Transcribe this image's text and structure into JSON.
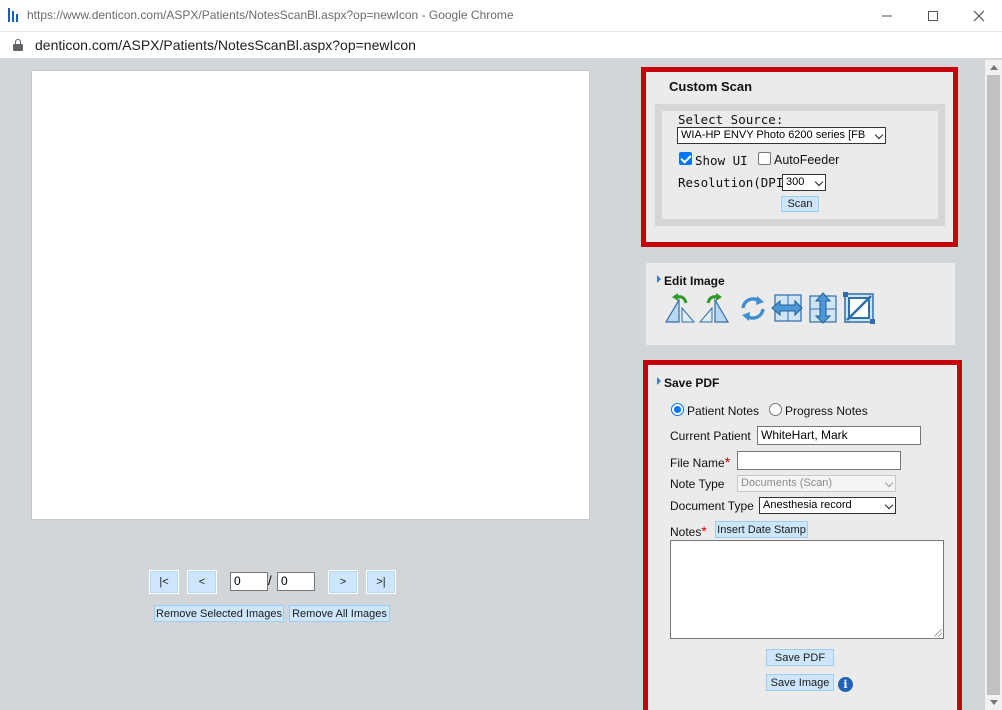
{
  "window": {
    "title": "https://www.denticon.com/ASPX/Patients/NotesScanBl.aspx?op=newIcon - Google Chrome",
    "address": "denticon.com/ASPX/Patients/NotesScanBl.aspx?op=newIcon"
  },
  "pager": {
    "first_label": "|<",
    "prev_label": "<",
    "current_page": "0",
    "separator": "/",
    "total_pages": "0",
    "next_label": ">",
    "last_label": ">|",
    "remove_selected_label": "Remove Selected Images",
    "remove_all_label": "Remove All Images"
  },
  "custom_scan": {
    "title": "Custom Scan",
    "source_label": "Select Source:",
    "source_value": "WIA-HP ENVY Photo 6200 series [FB",
    "show_ui_label": "Show UI",
    "show_ui_checked": true,
    "autofeeder_label": "AutoFeeder",
    "autofeeder_checked": false,
    "resolution_label": "Resolution(DPI):",
    "resolution_value": "300",
    "scan_label": "Scan"
  },
  "edit_image": {
    "title": "Edit Image",
    "tools": [
      "rotate-left-icon",
      "rotate-right-icon",
      "rotate-180-icon",
      "flip-horizontal-icon",
      "flip-vertical-icon",
      "crop-icon"
    ]
  },
  "save_pdf": {
    "title": "Save PDF",
    "note_kind_options": [
      "Patient Notes",
      "Progress Notes"
    ],
    "note_kind_selected": "Patient Notes",
    "current_patient_label": "Current Patient",
    "current_patient_value": "WhiteHart, Mark",
    "file_name_label": "File Name",
    "required_mark": "*",
    "file_name_value": "",
    "note_type_label": "Note Type",
    "note_type_value": "Documents (Scan)",
    "document_type_label": "Document Type",
    "document_type_value": "Anesthesia record",
    "notes_label": "Notes",
    "insert_date_stamp_label": "Insert Date Stamp",
    "notes_value": "",
    "save_pdf_label": "Save PDF",
    "save_image_label": "Save Image",
    "info_icon_text": "i"
  },
  "colors": {
    "highlight_border": "#c8000c",
    "button_bg": "#cde6fb",
    "page_bg": "#d3d6d9"
  }
}
